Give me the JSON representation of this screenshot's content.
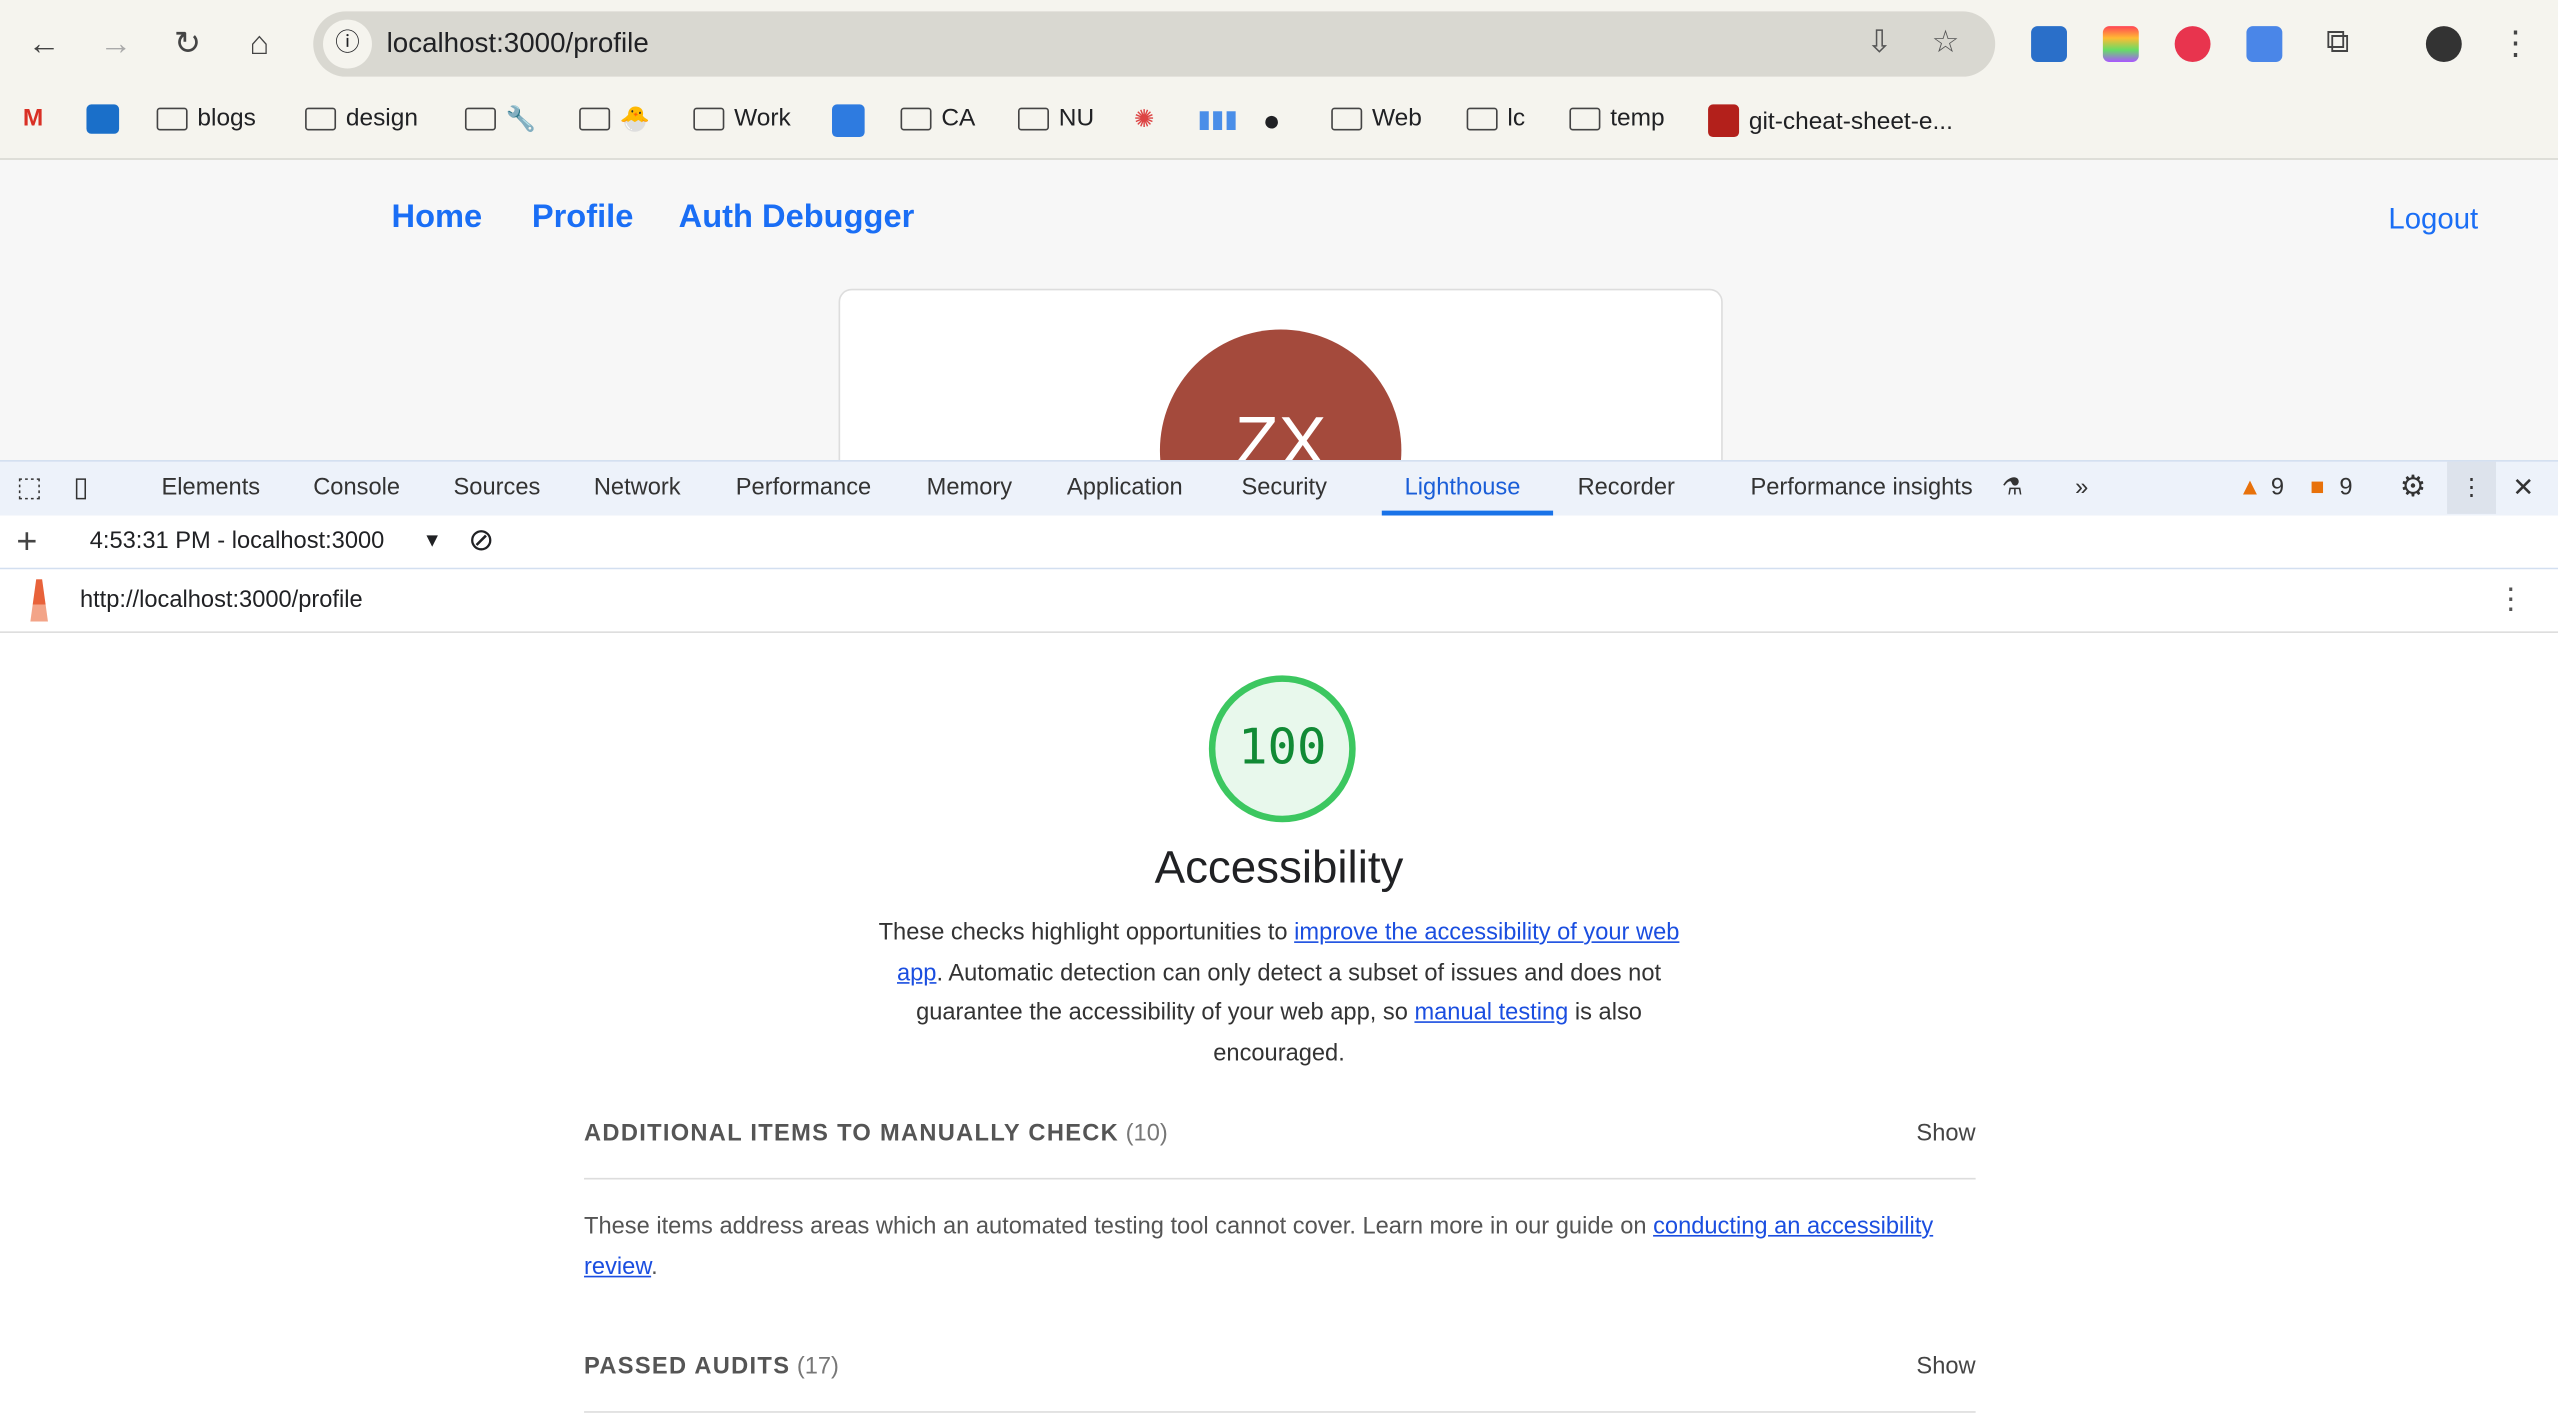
{
  "browser": {
    "url": "localhost:3000/profile",
    "bookmarks": [
      "blogs",
      "design",
      "Work",
      "CA",
      "NU",
      "Web",
      "lc",
      "temp",
      "git-cheat-sheet-e..."
    ]
  },
  "app": {
    "nav": [
      "Home",
      "Profile",
      "Auth Debugger"
    ],
    "logout": "Logout",
    "avatar_initials": "ZX"
  },
  "devtools": {
    "tabs": [
      "Elements",
      "Console",
      "Sources",
      "Network",
      "Performance",
      "Memory",
      "Application",
      "Security",
      "Lighthouse",
      "Recorder",
      "Performance insights"
    ],
    "active_tab": "Lighthouse",
    "warnings": "9",
    "issues": "9",
    "report_select": "4:53:31 PM - localhost:3000",
    "report_url": "http://localhost:3000/profile"
  },
  "report": {
    "score": "100",
    "score_color": "#3cc760",
    "category": "Accessibility",
    "desc_pre": "These checks highlight opportunities to ",
    "desc_link1": "improve the accessibility of your web app",
    "desc_mid": ". Automatic detection can only detect a subset of issues and does not guarantee the accessibility of your web app, so ",
    "desc_link2": "manual testing",
    "desc_post": " is also encouraged.",
    "groups": [
      {
        "title": "ADDITIONAL ITEMS TO MANUALLY CHECK",
        "count": "(10)",
        "show": "Show",
        "desc_pre": "These items address areas which an automated testing tool cannot cover. Learn more in our guide on ",
        "desc_link": "conducting an accessibility review",
        "desc_post": "."
      },
      {
        "title": "PASSED AUDITS",
        "count": "(17)",
        "show": "Show"
      }
    ]
  }
}
